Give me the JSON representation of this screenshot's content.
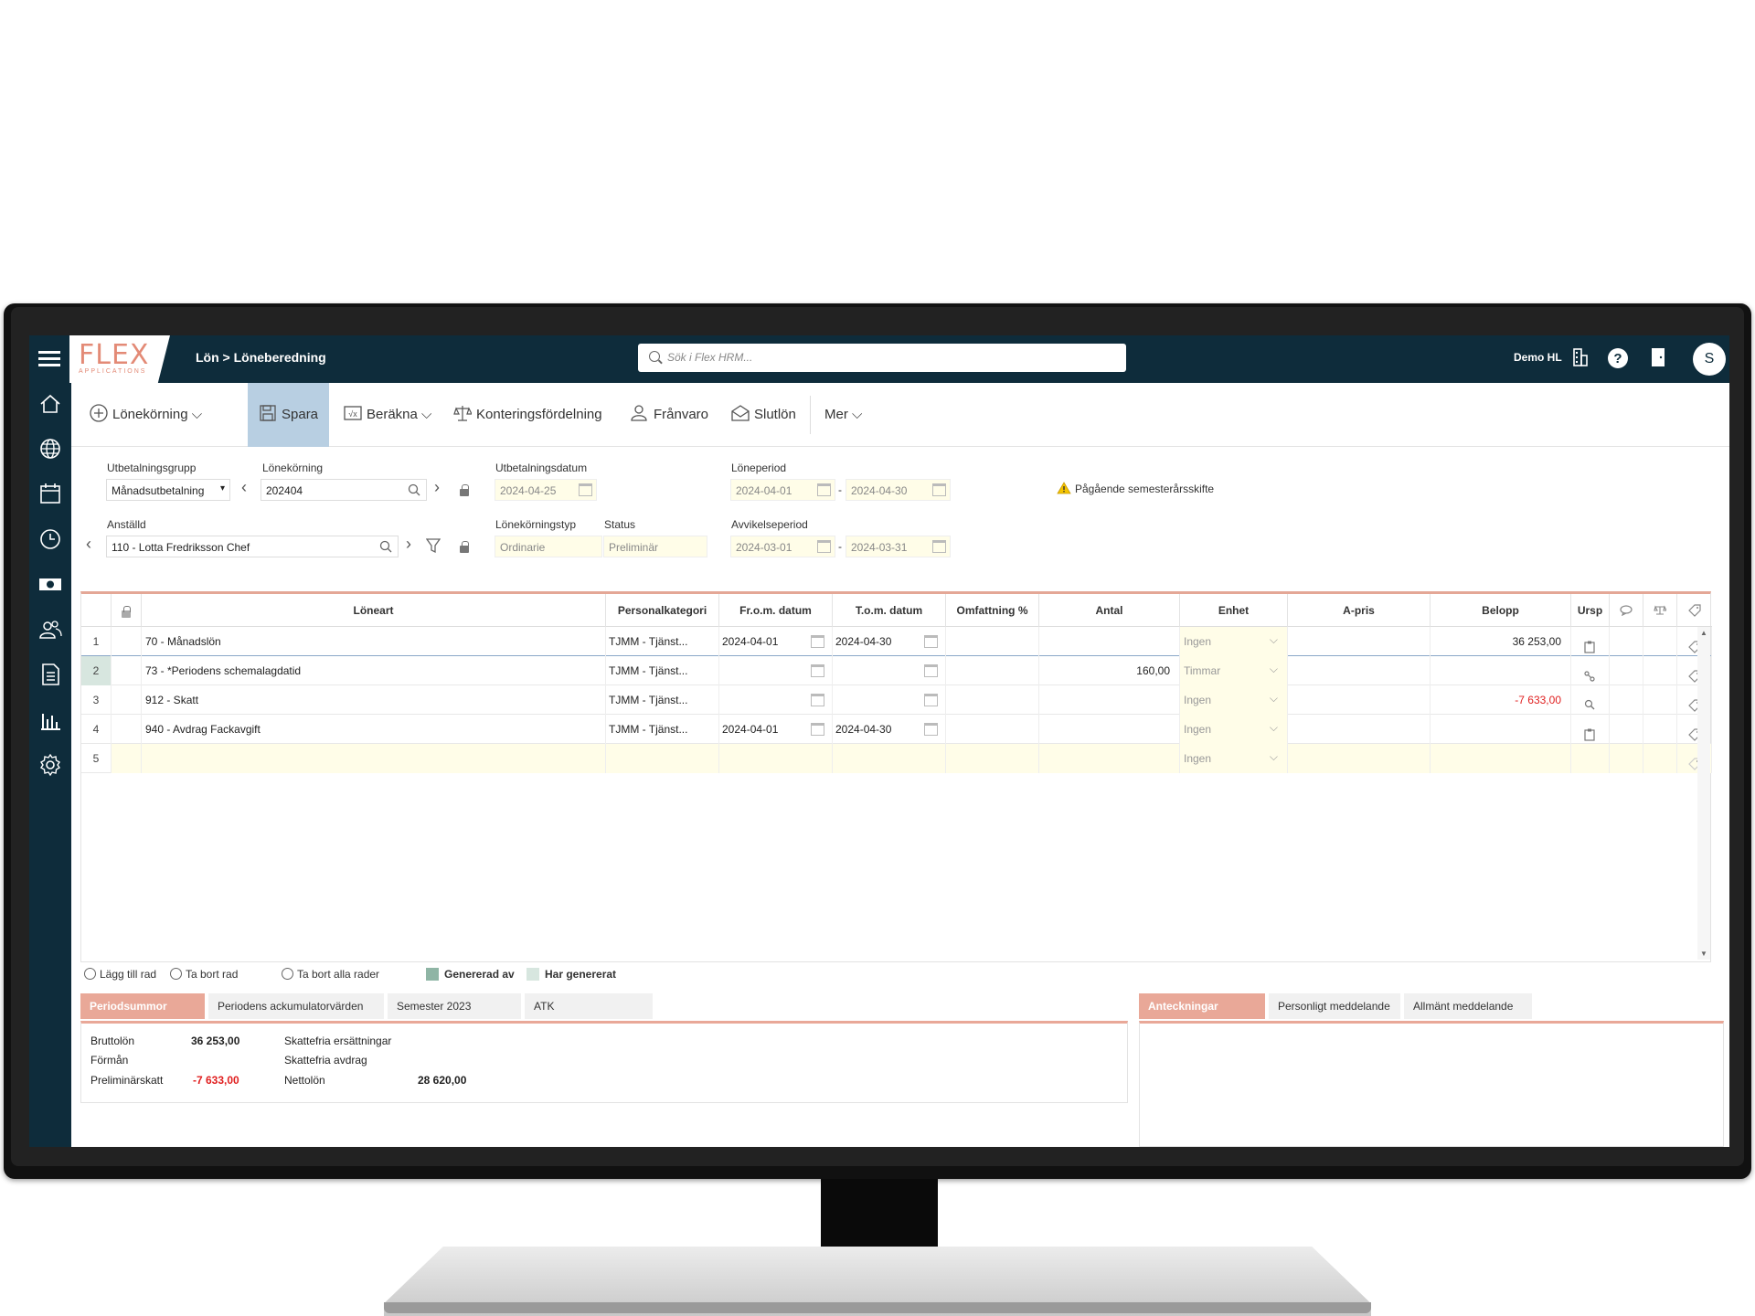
{
  "topbar": {
    "logo_word": "FLEX",
    "logo_sub": "APPLICATIONS",
    "breadcrumb": "Lön > Löneberedning",
    "search_placeholder": "Sök i Flex HRM...",
    "user_name": "Demo HL",
    "avatar_initial": "S"
  },
  "toolbar": {
    "lonekorning": "Lönekörning",
    "spara": "Spara",
    "berakna": "Beräkna",
    "konteringsfordelning": "Konteringsfördelning",
    "franvaro": "Frånvaro",
    "slutlon": "Slutlön",
    "mer": "Mer"
  },
  "form": {
    "utbetalningsgrupp_label": "Utbetalningsgrupp",
    "utbetalningsgrupp_value": "Månadsutbetalning",
    "lonekorning_label": "Lönekörning",
    "lonekorning_value": "202404",
    "utbetalningsdatum_label": "Utbetalningsdatum",
    "utbetalningsdatum_value": "2024-04-25",
    "loneperiod_label": "Löneperiod",
    "loneperiod_from": "2024-04-01",
    "loneperiod_to": "2024-04-30",
    "period_separator": "-",
    "warning": "Pågående semesterårsskifte",
    "anstalld_label": "Anställd",
    "anstalld_value": "110 - Lotta Fredriksson Chef",
    "lonekorningstyp_label": "Lönekörningstyp",
    "lonekorningstyp_value": "Ordinarie",
    "status_label": "Status",
    "status_value": "Preliminär",
    "avvikelseperiod_label": "Avvikelseperiod",
    "avvikelseperiod_from": "2024-03-01",
    "avvikelseperiod_to": "2024-03-31"
  },
  "grid": {
    "headers": {
      "loneart": "Löneart",
      "personalkategori": "Personalkategori",
      "from": "Fr.o.m. datum",
      "tom": "T.o.m. datum",
      "omfattning": "Omfattning %",
      "antal": "Antal",
      "enhet": "Enhet",
      "apris": "A-pris",
      "belopp": "Belopp",
      "ursp": "Ursp"
    },
    "rows": [
      {
        "nr": "1",
        "loneart": "70 - Månadslön",
        "personalkategori": "TJMM - Tjänst...",
        "from": "2024-04-01",
        "tom": "2024-04-30",
        "antal": "",
        "enhet": "Ingen",
        "belopp": "36 253,00"
      },
      {
        "nr": "2",
        "loneart": "73 - *Periodens schemalagdatid",
        "personalkategori": "TJMM - Tjänst...",
        "from": "",
        "tom": "",
        "antal": "160,00",
        "enhet": "Timmar",
        "belopp": ""
      },
      {
        "nr": "3",
        "loneart": "912 - Skatt",
        "personalkategori": "TJMM - Tjänst...",
        "from": "",
        "tom": "",
        "antal": "",
        "enhet": "Ingen",
        "belopp": "-7 633,00"
      },
      {
        "nr": "4",
        "loneart": "940 - Avdrag Fackavgift",
        "personalkategori": "TJMM - Tjänst...",
        "from": "2024-04-01",
        "tom": "2024-04-30",
        "antal": "",
        "enhet": "Ingen",
        "belopp": ""
      },
      {
        "nr": "5",
        "loneart": "",
        "personalkategori": "",
        "from": "",
        "tom": "",
        "antal": "",
        "enhet": "Ingen",
        "belopp": ""
      }
    ]
  },
  "row_actions": {
    "add": "Lägg till rad",
    "remove": "Ta bort rad",
    "remove_all": "Ta bort alla rader",
    "legend_generated_by": "Genererad av",
    "legend_has_generated": "Har genererat",
    "legend_generated_by_color": "#8fb5a5",
    "legend_has_generated_color": "#d7e6df"
  },
  "tabs_left": [
    "Periodsummor",
    "Periodens ackumulatorvärden",
    "Semester 2023",
    "ATK"
  ],
  "tabs_right": [
    "Anteckningar",
    "Personligt meddelande",
    "Allmänt meddelande"
  ],
  "summary": {
    "bruttolon_label": "Bruttolön",
    "bruttolon_value": "36 253,00",
    "forman_label": "Förmån",
    "prelskatt_label": "Preliminärskatt",
    "prelskatt_value": "-7 633,00",
    "skattefria_ers_label": "Skattefria ersättningar",
    "skattefria_avdrag_label": "Skattefria avdrag",
    "nettolon_label": "Nettolön",
    "nettolon_value": "28 620,00"
  },
  "colors": {
    "topbar": "#0e2c3b",
    "accent": "#e9a898",
    "negative": "#e02020"
  }
}
